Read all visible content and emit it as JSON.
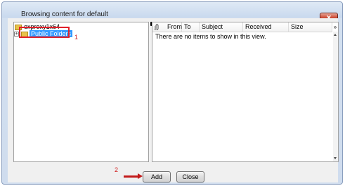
{
  "window": {
    "title": "Browsing content for default",
    "close_glyph": "✕"
  },
  "tree": {
    "root_label": "exproxy1x64",
    "child_label": "Public Folders",
    "expander_glyph": "+"
  },
  "annotations": {
    "marker_1": "1",
    "marker_2": "2",
    "highlight_color": "#e0202a"
  },
  "list": {
    "columns": [
      {
        "label": "",
        "icon": "paperclip-icon"
      },
      {
        "label": "From"
      },
      {
        "label": "To"
      },
      {
        "label": "Subject"
      },
      {
        "label": "Received"
      },
      {
        "label": "Size"
      }
    ],
    "chevron_glyph": "»",
    "empty_text": "There are no items to show in this view."
  },
  "buttons": {
    "add_label": "Add",
    "close_label": "Close"
  },
  "colors": {
    "selection": "#3399ff",
    "title_close_button": "#c9452f"
  }
}
